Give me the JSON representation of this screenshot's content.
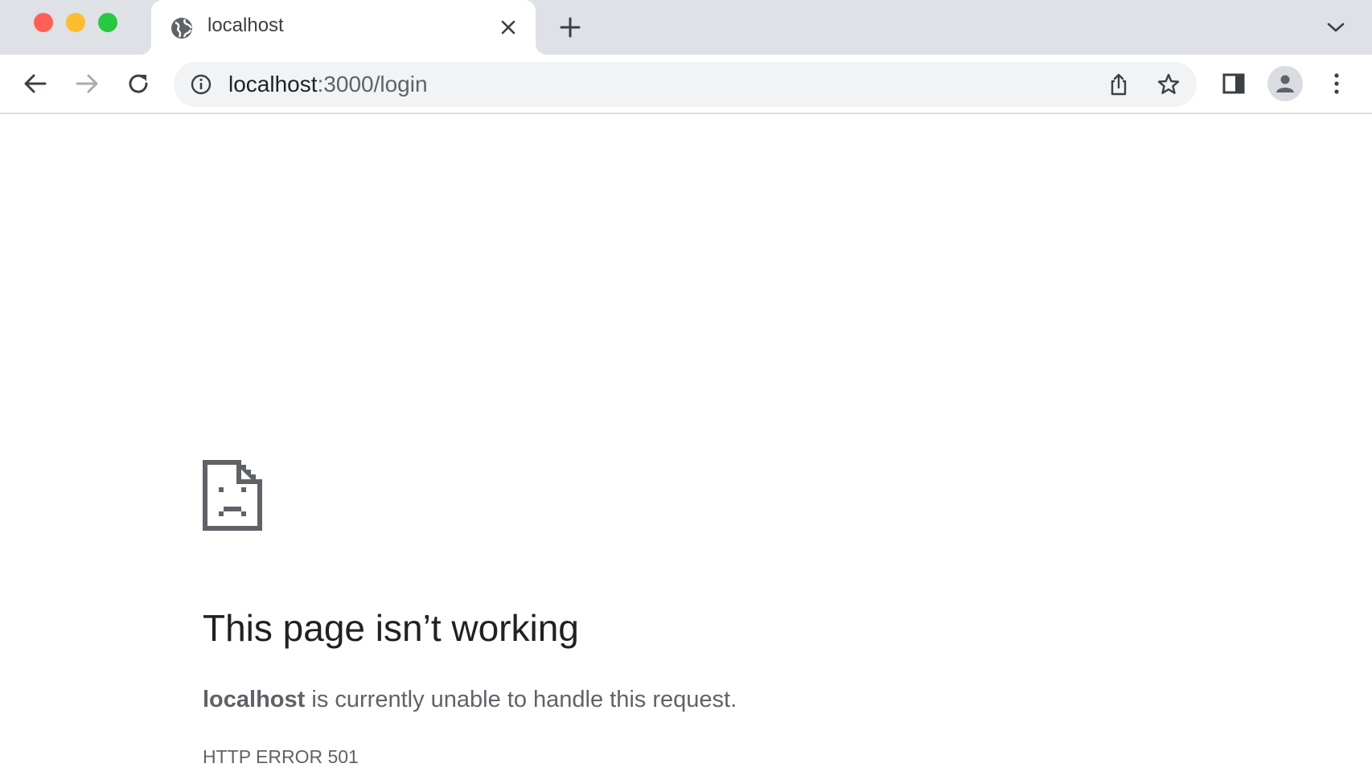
{
  "window": {
    "controls": [
      "close",
      "minimize",
      "zoom"
    ]
  },
  "tabs": [
    {
      "title": "localhost",
      "favicon": "globe-icon",
      "active": true
    }
  ],
  "toolbar": {
    "back_icon": "arrow-left-icon",
    "forward_icon": "arrow-right-icon",
    "reload_icon": "reload-icon",
    "new_tab_icon": "plus-icon",
    "tab_search_icon": "chevron-down-icon"
  },
  "omnibox": {
    "host": "localhost",
    "path": ":3000/login",
    "info_icon": "info-icon",
    "actions": [
      "share-icon",
      "star-icon"
    ]
  },
  "toolbar_right": {
    "side_panel_icon": "side-panel-icon",
    "profile_icon": "profile-icon",
    "menu_icon": "more-vert-icon"
  },
  "error": {
    "icon": "sad-page-icon",
    "title": "This page isn’t working",
    "host": "localhost",
    "message": " is currently unable to handle this request.",
    "code": "HTTP ERROR 501"
  },
  "colors": {
    "tabstrip_bg": "#dee1e6",
    "omnibox_bg": "#f1f3f4",
    "title_text": "#202124",
    "secondary_text": "#5f6368",
    "close_red": "#ff5f57",
    "minimize_yellow": "#febc2e",
    "zoom_green": "#28c840"
  }
}
